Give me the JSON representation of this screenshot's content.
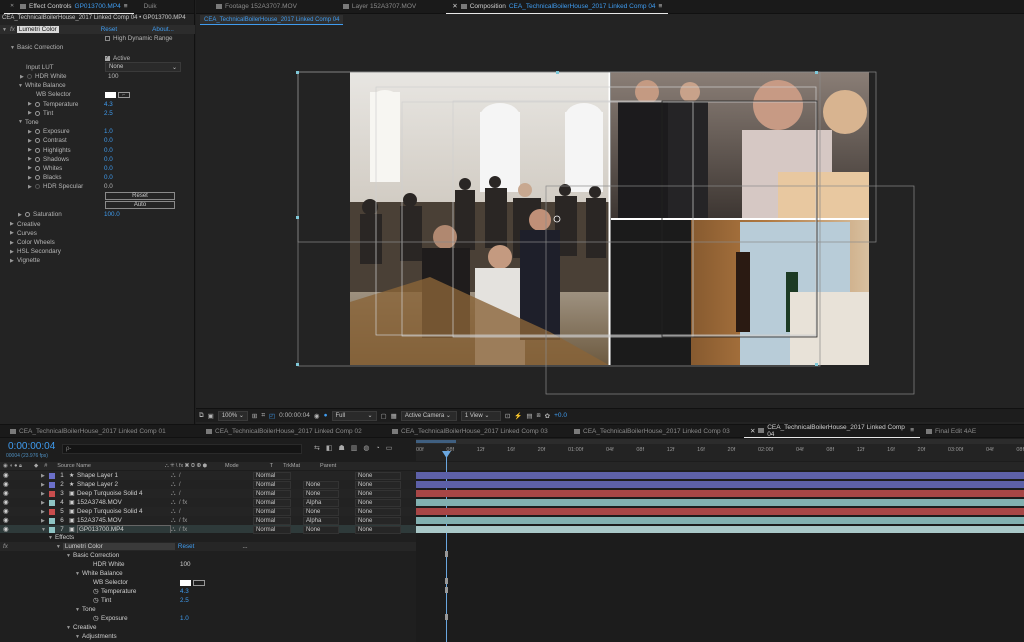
{
  "ec": {
    "tab1": "Effect Controls",
    "tab1_link": "GP013700.MP4",
    "tab2": "Duik",
    "path": "CEA_TechnicalBoilerHouse_2017 Linked Comp 04 • GP013700.MP4",
    "fx": "fx",
    "effect": "Lumetri Color",
    "reset": "Reset",
    "about": "About...",
    "hdr": "High Dynamic Range",
    "basic": "Basic Correction",
    "active": "Active",
    "input_lut": "Input LUT",
    "input_lut_val": "None",
    "hdr_white": "HDR White",
    "hdr_white_val": "100",
    "wb": "White Balance",
    "wb_sel": "WB Selector",
    "temp": "Temperature",
    "temp_val": "4.3",
    "tint": "Tint",
    "tint_val": "2.5",
    "tone": "Tone",
    "exposure": "Exposure",
    "exposure_val": "1.0",
    "contrast": "Contrast",
    "contrast_val": "0.0",
    "highlights": "Highlights",
    "highlights_val": "0.0",
    "shadows": "Shadows",
    "shadows_val": "0.0",
    "whites": "Whites",
    "whites_val": "0.0",
    "blacks": "Blacks",
    "blacks_val": "0.0",
    "hdr_spec": "HDR Specular",
    "hdr_spec_val": "0.0",
    "reset_btn": "Reset",
    "auto_btn": "Auto",
    "saturation": "Saturation",
    "saturation_val": "100.0",
    "creative": "Creative",
    "curves": "Curves",
    "wheels": "Color Wheels",
    "hsl": "HSL Secondary",
    "vignette": "Vignette"
  },
  "comp": {
    "tab_footage": "Footage 152A3707.MOV",
    "tab_layer": "Layer 152A3707.MOV",
    "tab_comp_label": "Composition",
    "tab_comp_link": "CEA_TechnicalBoilerHouse_2017 Linked Comp 04",
    "crumb": "CEA_TechnicalBoilerHouse_2017 Linked Comp 04",
    "zoom": "100%",
    "time": "0:00:00:04",
    "res": "Full",
    "camera": "Active Camera",
    "views": "1 View",
    "exposure": "+0.0"
  },
  "tl": {
    "tabs": [
      "CEA_TechnicalBoilerHouse_2017 Linked Comp 01",
      "CEA_TechnicalBoilerHouse_2017 Linked Comp 02",
      "CEA_TechnicalBoilerHouse_2017 Linked Comp 03",
      "CEA_TechnicalBoilerHouse_2017 Linked Comp 03",
      "CEA_TechnicalBoilerHouse_2017 Linked Comp 04",
      "Final Edit 4AE"
    ],
    "timecode": "0:00:00:04",
    "fps": "00004 (23.976 fps)",
    "search_placeholder": "ρ-",
    "col_num": "#",
    "col_source": "Source Name",
    "col_mode": "Mode",
    "col_t": "T",
    "col_trkmat": "TrkMat",
    "col_parent": "Parent",
    "ruler": [
      "00f",
      "08f",
      "12f",
      "16f",
      "20f",
      "01:00f",
      "04f",
      "08f",
      "12f",
      "16f",
      "20f",
      "02:00f",
      "04f",
      "08f",
      "12f",
      "16f",
      "20f",
      "03:00f",
      "04f",
      "08f"
    ],
    "layers": [
      {
        "num": "1",
        "name": "Shape Layer 1",
        "color": "#6b6fc9",
        "mode": "Normal",
        "trk": "",
        "parent": "None",
        "bar": "#5d60a8"
      },
      {
        "num": "2",
        "name": "Shape Layer 2",
        "color": "#6b6fc9",
        "mode": "Normal",
        "trk": "None",
        "parent": "None",
        "bar": "#5d60a8"
      },
      {
        "num": "3",
        "name": "Deep Turquoise Solid 4",
        "color": "#c84d4d",
        "mode": "Normal",
        "trk": "None",
        "parent": "None",
        "bar": "#a84646"
      },
      {
        "num": "4",
        "name": "152A3748.MOV",
        "color": "#8ec4c4",
        "mode": "Normal",
        "trk": "Alpha",
        "parent": "None",
        "bar": "#82b0b0"
      },
      {
        "num": "5",
        "name": "Deep Turquoise Solid 4",
        "color": "#c84d4d",
        "mode": "Normal",
        "trk": "None",
        "parent": "None",
        "bar": "#a84646"
      },
      {
        "num": "6",
        "name": "152A3745.MOV",
        "color": "#8ec4c4",
        "mode": "Normal",
        "trk": "Alpha",
        "parent": "None",
        "bar": "#82b0b0"
      },
      {
        "num": "7",
        "name": "GP013700.MP4",
        "color": "#8ec4c4",
        "mode": "Normal",
        "trk": "None",
        "parent": "None",
        "bar": "#a9c8c8"
      }
    ],
    "effects": "Effects",
    "lumetri": "Lumetri Color",
    "reset": "Reset",
    "dots": "...",
    "basic": "Basic Correction",
    "hdr_white": "HDR White",
    "hdr_white_val": "100",
    "wb": "White Balance",
    "wb_sel": "WB Selector",
    "temp": "Temperature",
    "temp_val": "4.3",
    "tint": "Tint",
    "tint_val": "2.5",
    "tone": "Tone",
    "exposure": "Exposure",
    "exposure_val": "1.0",
    "creative": "Creative",
    "adjustments": "Adjustments",
    "fx": "fx"
  }
}
